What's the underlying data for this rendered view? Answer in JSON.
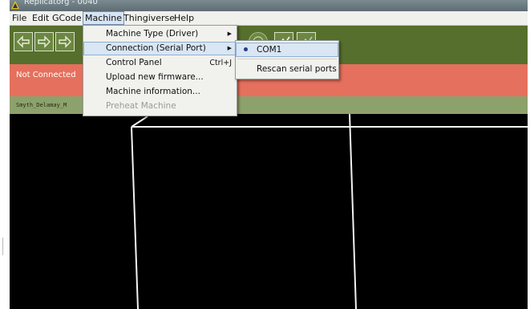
{
  "window": {
    "title": "Replicatorg - 0040"
  },
  "menubar": {
    "items": [
      {
        "label": "File"
      },
      {
        "label": "Edit"
      },
      {
        "label": "GCode"
      },
      {
        "label": "Machine"
      },
      {
        "label": "Thingiverse"
      },
      {
        "label": "Help"
      }
    ],
    "active": "Machine"
  },
  "status": {
    "text": "Not Connected",
    "color": "#e5705d"
  },
  "file_tab": {
    "label": "Smyth_Delamay_M"
  },
  "machine_menu": {
    "items": [
      {
        "label": "Machine Type (Driver)",
        "submenu": true
      },
      {
        "label": "Connection (Serial Port)",
        "submenu": true,
        "highlighted": true
      },
      {
        "label": "Control Panel",
        "shortcut": "Ctrl+J"
      },
      {
        "label": "Upload new firmware..."
      },
      {
        "label": "Machine information..."
      },
      {
        "label": "Preheat Machine",
        "disabled": true
      }
    ]
  },
  "port_submenu": {
    "items": [
      {
        "label": "COM1",
        "selected": true
      },
      {
        "label": "Rescan serial ports"
      }
    ]
  },
  "colors": {
    "toolbar": "#566f2c",
    "file_tab_bar": "#8da16c",
    "viewport": "#000000",
    "menu_highlight": "#d9e6f3"
  }
}
